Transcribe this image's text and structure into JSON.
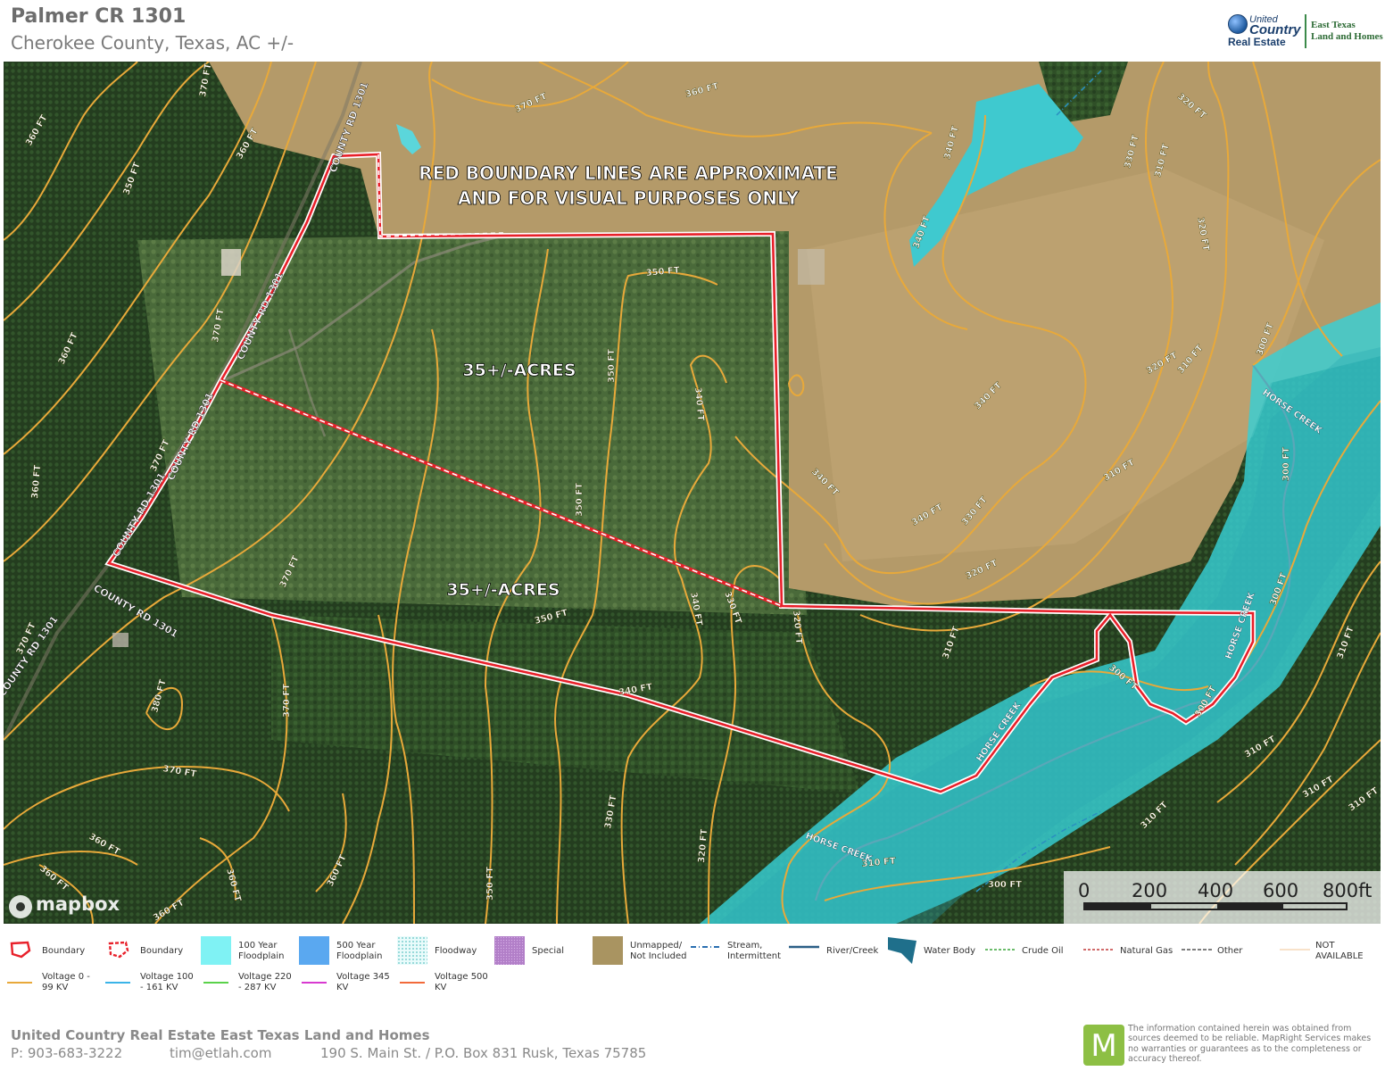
{
  "header": {
    "title": "Palmer CR 1301",
    "subtitle": "Cherokee County, Texas,  AC +/-"
  },
  "logo": {
    "line1": "United",
    "line2": "Country",
    "line3": "Real Estate",
    "side1": "East Texas",
    "side2": "Land and Homes"
  },
  "map": {
    "notice_line1": "RED BOUNDARY LINES ARE APPROXIMATE",
    "notice_line2": "AND FOR VISUAL PURPOSES ONLY",
    "tract_north_label": "35+/-ACRES",
    "tract_south_label": "35+/-ACRES",
    "road_labels": [
      "COUNTY RD 1301",
      "COUNTY RD 1301",
      "COUNTY RD 1301",
      "COUNTY RD 1301",
      "COUNTY RD 1301",
      "COUNTY RD 1301"
    ],
    "creek_labels": [
      "HORSE CREEK",
      "HORSE CREEK",
      "HORSE CREEK",
      "HORSE CREEK"
    ],
    "attribution": "mapbox",
    "colors": {
      "boundary": "#e8202a",
      "contour": "#e8a93a",
      "floodplain": "#37cfd6",
      "pond": "#3fc9cf"
    }
  },
  "contours": [
    "380 FT",
    "370 FT",
    "370 FT",
    "370 FT",
    "370 FT",
    "370 FT",
    "370 FT",
    "370 FT",
    "370 FT",
    "360 FT",
    "360 FT",
    "360 FT",
    "360 FT",
    "360 FT",
    "360 FT",
    "360 FT",
    "360 FT",
    "360 FT",
    "360 FT",
    "350 FT",
    "350 FT",
    "350 FT",
    "350 FT",
    "350 FT",
    "350 FT",
    "340 FT",
    "340 FT",
    "340 FT",
    "340 FT",
    "340 FT",
    "340 FT",
    "340 FT",
    "340 FT",
    "330 FT",
    "330 FT",
    "330 FT",
    "330 FT",
    "320 FT",
    "320 FT",
    "320 FT",
    "320 FT",
    "320 FT",
    "320 FT",
    "310 FT",
    "310 FT",
    "310 FT",
    "310 FT",
    "310 FT",
    "310 FT",
    "310 FT",
    "310 FT",
    "310 FT",
    "310 FT",
    "300 FT",
    "300 FT",
    "300 FT",
    "300 FT",
    "300 FT",
    "300 FT"
  ],
  "scale": {
    "labels": [
      "0",
      "200",
      "400",
      "600",
      "800ft"
    ]
  },
  "legend": [
    {
      "label": "Boundary",
      "type": "boundary-solid",
      "color": "#e8202a"
    },
    {
      "label": "Boundary",
      "type": "boundary-dashed",
      "color": "#e8202a"
    },
    {
      "label": "100 Year Floodplain",
      "type": "fill",
      "color": "#7ff2f4"
    },
    {
      "label": "500 Year Floodplain",
      "type": "fill",
      "color": "#5aa8f0"
    },
    {
      "label": "Floodway",
      "type": "hatch",
      "color": "#9fe0e0"
    },
    {
      "label": "Special",
      "type": "fill",
      "color": "#b27fc8"
    },
    {
      "label": "Unmapped/ Not Included",
      "type": "fill",
      "color": "#a99461"
    },
    {
      "label": "Stream, Intermittent",
      "type": "dashdot",
      "color": "#2a6fb0"
    },
    {
      "label": "River/Creek",
      "type": "line",
      "color": "#2b5f86"
    },
    {
      "label": "Water Body",
      "type": "waterbody",
      "color": "#1f6f8b"
    },
    {
      "label": "Crude Oil",
      "type": "dashed",
      "color": "#3aa63a"
    },
    {
      "label": "Natural Gas",
      "type": "dashed",
      "color": "#c23a3a"
    },
    {
      "label": "Other",
      "type": "dashed",
      "color": "#555555"
    },
    {
      "label": "NOT AVAILABLE",
      "type": "line",
      "color": "#f5d9b8"
    },
    {
      "label": "Voltage 0 - 99 KV",
      "type": "line",
      "color": "#e8a93a"
    },
    {
      "label": "Voltage 100 - 161 KV",
      "type": "line",
      "color": "#3ab4e8"
    },
    {
      "label": "Voltage 220 - 287 KV",
      "type": "line",
      "color": "#5ad24a"
    },
    {
      "label": "Voltage 345 KV",
      "type": "line",
      "color": "#d83ad0"
    },
    {
      "label": "Voltage 500 KV",
      "type": "line",
      "color": "#f26a3a"
    }
  ],
  "footer": {
    "company": "United Country Real Estate East Texas Land and Homes",
    "phone": "P: 903-683-3222",
    "email": "tim@etlah.com",
    "address": "190 S. Main St. / P.O. Box 831 Rusk, Texas 75785",
    "mapright_letter": "M",
    "disclaimer": "The information contained herein was obtained from sources deemed to be reliable. MapRight Services makes no warranties or guarantees as to the completeness or accuracy thereof."
  }
}
